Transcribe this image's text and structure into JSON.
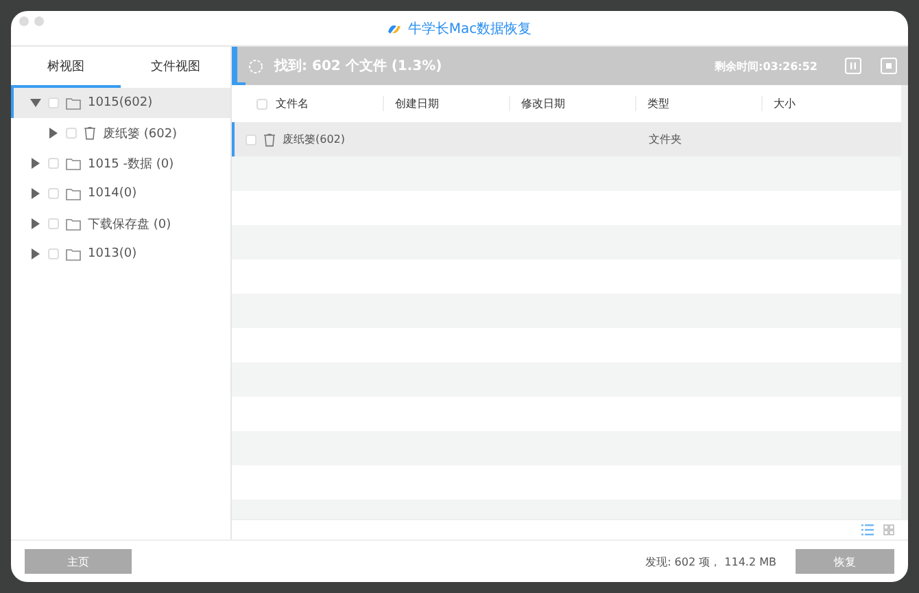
{
  "window": {
    "title": "牛学长Mac数据恢复"
  },
  "tabs": [
    {
      "label": "树视图",
      "selected": true
    },
    {
      "label": "文件视图",
      "selected": false
    }
  ],
  "tree": [
    {
      "label": "1015(602)",
      "kind": "folder",
      "expanded": true,
      "selected": true,
      "checked": false,
      "children": [
        {
          "label": "废纸篓 (602)",
          "kind": "trash",
          "expanded": false,
          "selected": false,
          "checked": false
        }
      ]
    },
    {
      "label": "1015 -数据 (0)",
      "kind": "folder",
      "expanded": false,
      "selected": false,
      "checked": false
    },
    {
      "label": "1014(0)",
      "kind": "folder",
      "expanded": false,
      "selected": false,
      "checked": false
    },
    {
      "label": "下载保存盘 (0)",
      "kind": "folder",
      "expanded": false,
      "selected": false,
      "checked": false
    },
    {
      "label": "1013(0)",
      "kind": "folder",
      "expanded": false,
      "selected": false,
      "checked": false
    }
  ],
  "scan": {
    "status": "找到: 602 个文件 (1.3%)",
    "remaining": "剩余时间:03:26:52",
    "level": 0.013
  },
  "table": {
    "all_checked": false,
    "columns": [
      "文件名",
      "创建日期",
      "修改日期",
      "类型",
      "大小"
    ],
    "rows": [
      {
        "name": "废纸篓(602)",
        "kind": "trash",
        "type": "文件夹",
        "selected": true,
        "checked": false
      }
    ]
  },
  "footer": {
    "home_button": "主页",
    "summary": "发现: 602 项， 114.2 MB",
    "recover_button": "恢复",
    "recover_disabled": true
  }
}
